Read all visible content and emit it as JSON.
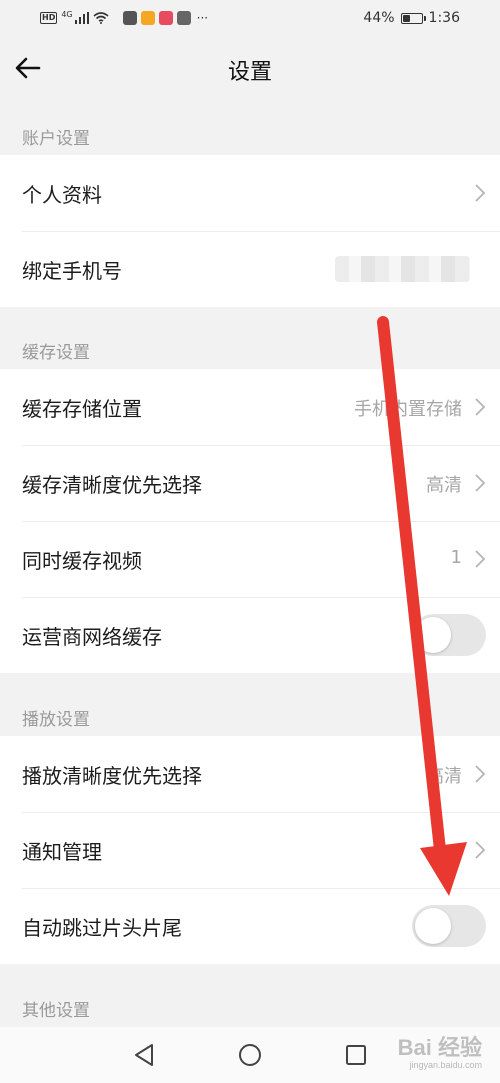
{
  "status_bar": {
    "hd": "HD",
    "network": "4G",
    "battery_percent": "44%",
    "battery_level": 0.44,
    "time": "1:36",
    "more": "···",
    "app_icon_colors": [
      "#555555",
      "#f5a623",
      "#e84a5f",
      "#666666"
    ]
  },
  "header": {
    "title": "设置",
    "back_icon": "arrow-left-icon"
  },
  "sections": {
    "account": {
      "label": "账户设置",
      "items": {
        "profile": {
          "label": "个人资料"
        },
        "bind_phone": {
          "label": "绑定手机号"
        }
      }
    },
    "cache": {
      "label": "缓存设置",
      "items": {
        "storage": {
          "label": "缓存存储位置",
          "value": "手机内置存储"
        },
        "quality": {
          "label": "缓存清晰度优先选择",
          "value": "高清"
        },
        "concurrent": {
          "label": "同时缓存视频",
          "value": "1"
        },
        "carrier": {
          "label": "运营商网络缓存",
          "enabled": false
        }
      }
    },
    "playback": {
      "label": "播放设置",
      "items": {
        "quality": {
          "label": "播放清晰度优先选择",
          "value": "高清"
        },
        "notifications": {
          "label": "通知管理"
        },
        "skip_intro": {
          "label": "自动跳过片头片尾",
          "enabled": false
        }
      }
    },
    "other": {
      "label": "其他设置"
    }
  },
  "nav_bar": {
    "back_icon": "triangle-back-icon",
    "home_icon": "circle-home-icon",
    "recents_icon": "square-recents-icon"
  },
  "watermark": {
    "text": "Bai 经验",
    "sub": "jingyan.baidu.com"
  },
  "colors": {
    "background": "#f2f2f2",
    "arrow": "#e8382f",
    "toggle_off": "#e6e6e6"
  }
}
